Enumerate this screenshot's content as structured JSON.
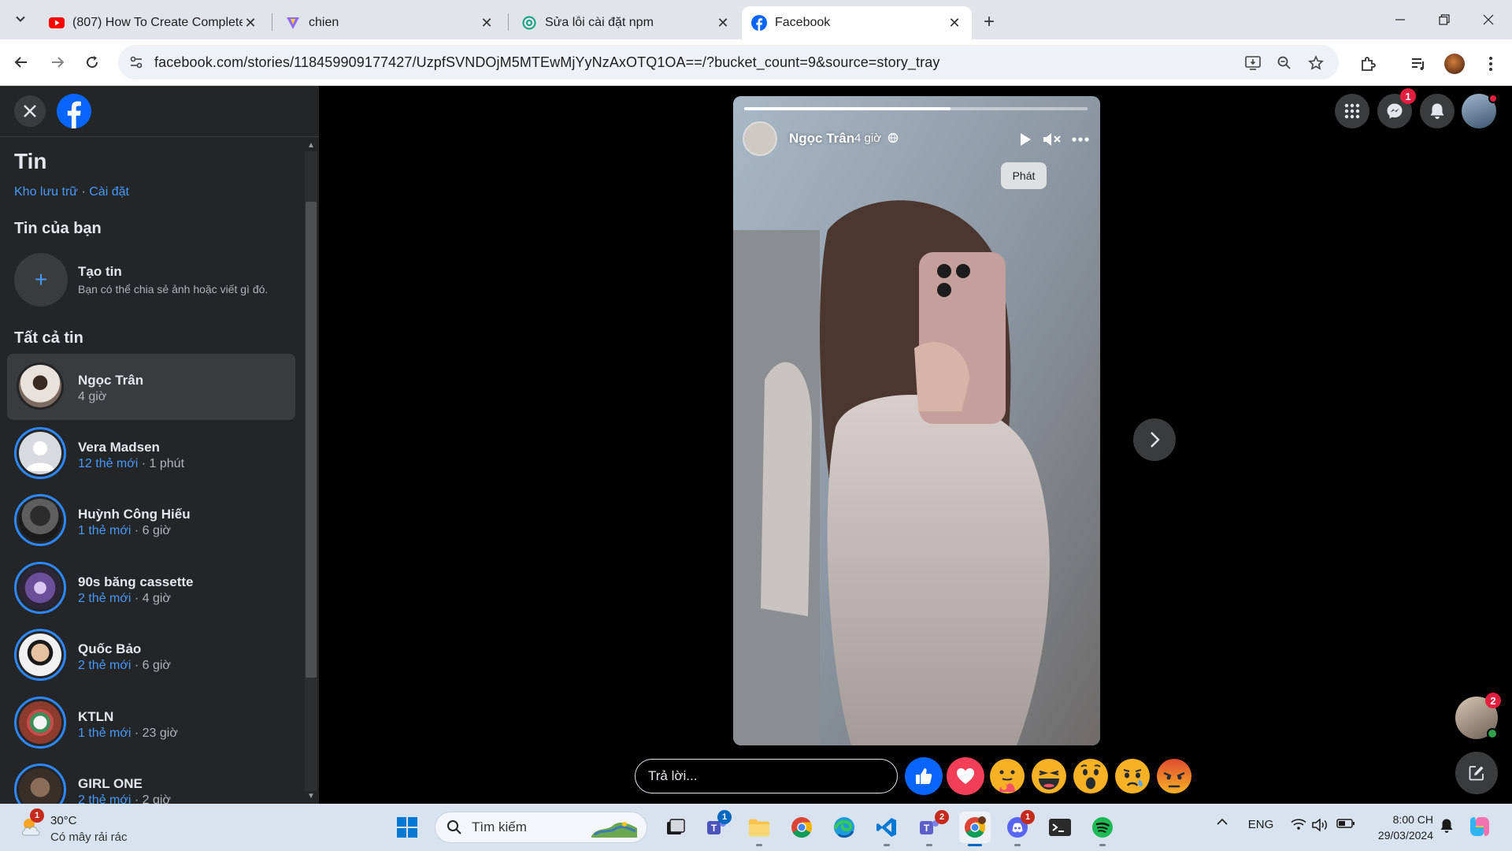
{
  "browser": {
    "tabs": [
      {
        "title": "(807) How To Create Complete",
        "favicon": "youtube-icon"
      },
      {
        "title": "chien",
        "favicon": "vite-icon"
      },
      {
        "title": "Sửa lỗi cài đặt npm",
        "favicon": "chatgpt-icon"
      },
      {
        "title": "Facebook",
        "favicon": "facebook-icon"
      }
    ],
    "url": "facebook.com/stories/118459909177427/UzpfSVNDOjM5MTEwMjYyNzAxOTQ1OA==/?bucket_count=9&source=story_tray"
  },
  "sidebar": {
    "title": "Tin",
    "archive_link": "Kho lưu trữ",
    "link_separator": "·",
    "settings_link": "Cài đặt",
    "your_story_heading": "Tin của bạn",
    "create_title": "Tạo tin",
    "create_subtitle": "Bạn có thể chia sẻ ảnh hoặc viết gì đó.",
    "all_stories_heading": "Tất cả tin",
    "stories": [
      {
        "name": "Ngọc Trân",
        "new_count": "",
        "time": "4 giờ",
        "active": true
      },
      {
        "name": "Vera Madsen",
        "new_count": "12 thẻ mới",
        "time": " · 1 phút",
        "active": false
      },
      {
        "name": "Huỳnh Công Hiếu",
        "new_count": "1 thẻ mới",
        "time": " · 6 giờ",
        "active": false
      },
      {
        "name": "90s băng cassette",
        "new_count": "2 thẻ mới",
        "time": " · 4 giờ",
        "active": false
      },
      {
        "name": "Quốc Bảo",
        "new_count": "2 thẻ mới",
        "time": " · 6 giờ",
        "active": false
      },
      {
        "name": "KTLN",
        "new_count": "1 thẻ mới",
        "time": " · 23 giờ",
        "active": false
      },
      {
        "name": "GIRL ONE",
        "new_count": "2 thẻ mới",
        "time": " · 2 giờ",
        "active": false
      }
    ]
  },
  "story": {
    "author": "Ngọc Trân",
    "time": "4 giờ",
    "progress": 0.6,
    "tooltip": "Phát",
    "reply_placeholder": "Trả lời...",
    "reactions": [
      "like",
      "love",
      "care",
      "haha",
      "wow",
      "sad",
      "angry"
    ]
  },
  "header_badges": {
    "messenger": "1",
    "chat_head": "2"
  },
  "taskbar": {
    "weather_temp": "30°C",
    "weather_desc": "Có mây rải rác",
    "weather_badge": "1",
    "search_label": "Tìm kiếm",
    "teams_badge": "1",
    "teams2_badge": "2",
    "discord_badge": "1",
    "language": "ENG",
    "time": "8:00 CH",
    "date": "29/03/2024"
  }
}
